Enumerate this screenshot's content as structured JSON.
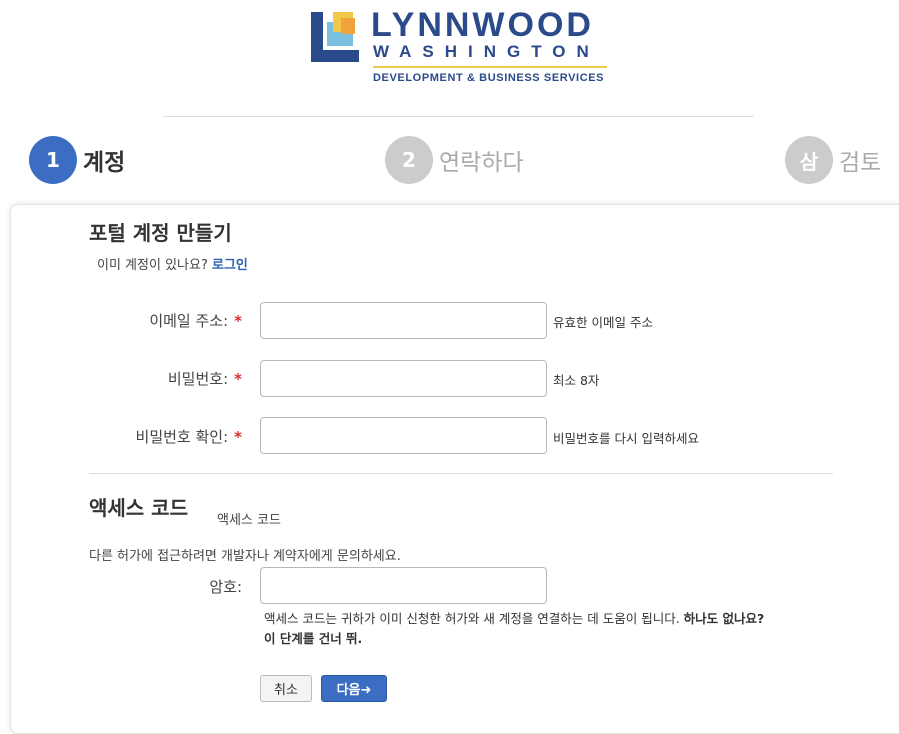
{
  "logo": {
    "title": "LYNNWOOD",
    "subtitle": "WASHINGTON",
    "tagline": "DEVELOPMENT & BUSINESS SERVICES"
  },
  "steps": [
    {
      "number": "1",
      "label": "계정",
      "state": "active"
    },
    {
      "number": "2",
      "label": "연락하다",
      "state": "inactive"
    },
    {
      "number": "삼",
      "label": "검토",
      "state": "inactive"
    }
  ],
  "form": {
    "title": "포털 계정 만들기",
    "have_account_text": "이미 계정이 있나요?",
    "login_link": "로그인",
    "fields": [
      {
        "label": "이메일 주소:",
        "required_mark": "*",
        "value": "",
        "hint": "유효한 이메일 주소"
      },
      {
        "label": "비밀번호:",
        "required_mark": "*",
        "value": "",
        "hint": "최소 8자"
      },
      {
        "label": "비밀번호 확인:",
        "required_mark": "*",
        "value": "",
        "hint": "비밀번호를 다시 입력하세요"
      }
    ]
  },
  "access": {
    "title": "액세스 코드",
    "subtitle": "액세스 코드",
    "instruction": "다른 허가에 접근하려면 개발자나 계약자에게 문의하세요.",
    "code_label": "암호:",
    "code_value": "",
    "help_text": "액세스 코드는 귀하가 이미 신청한 허가와 새 계정을 연결하는 데 도움이 됩니다.",
    "help_bold_1": "하나도 없나요?",
    "help_bold_2": "이 단계를 건너 뛰."
  },
  "buttons": {
    "cancel": "취소",
    "next": "다음➜"
  },
  "colors": {
    "brand": "#2b4a8b",
    "accent": "#3b6ec2",
    "required": "#d9302c",
    "inactive_step": "#cccccc"
  }
}
